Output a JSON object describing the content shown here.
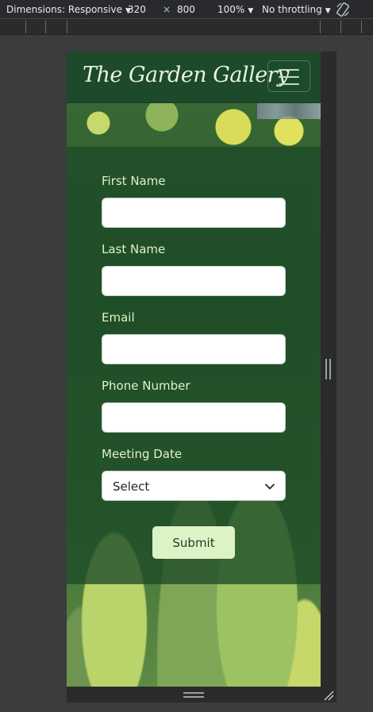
{
  "devtools": {
    "dimensions_label": "Dimensions: Responsive",
    "width": "320",
    "times": "×",
    "height": "800",
    "zoom": "100%",
    "throttling": "No throttling",
    "icons": [
      "caret-down-icon",
      "rotate-icon",
      "resize-grip-icon"
    ]
  },
  "site": {
    "brand": "The Garden Gallery",
    "nav_toggle_icon": "hamburger-icon"
  },
  "form": {
    "fields": [
      {
        "label": "First Name",
        "value": ""
      },
      {
        "label": "Last Name",
        "value": ""
      },
      {
        "label": "Email",
        "value": ""
      },
      {
        "label": "Phone Number",
        "value": ""
      }
    ],
    "meeting_date": {
      "label": "Meeting Date",
      "selected": "Select"
    },
    "submit_label": "Submit"
  },
  "colors": {
    "navbar": "#1c4a2a",
    "label_text": "#dff2c4",
    "submit_bg": "#dcf3c6"
  }
}
